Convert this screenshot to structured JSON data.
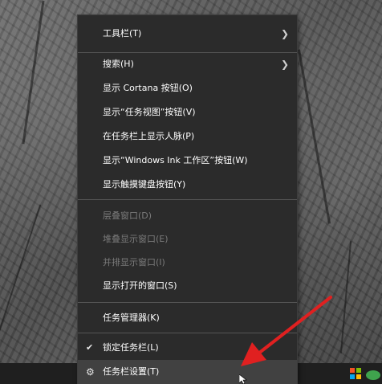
{
  "menu": {
    "items": [
      {
        "label": "工具栏(T)",
        "enabled": true,
        "submenu": true
      },
      {
        "label": "搜索(H)",
        "enabled": true,
        "submenu": true
      },
      {
        "label": "显示 Cortana 按钮(O)",
        "enabled": true
      },
      {
        "label": "显示“任务视图”按钮(V)",
        "enabled": true
      },
      {
        "label": "在任务栏上显示人脉(P)",
        "enabled": true
      },
      {
        "label": "显示“Windows Ink 工作区”按钮(W)",
        "enabled": true
      },
      {
        "label": "显示触摸键盘按钮(Y)",
        "enabled": true
      },
      {
        "label": "层叠窗口(D)",
        "enabled": false
      },
      {
        "label": "堆叠显示窗口(E)",
        "enabled": false
      },
      {
        "label": "并排显示窗口(I)",
        "enabled": false
      },
      {
        "label": "显示打开的窗口(S)",
        "enabled": true
      },
      {
        "label": "任务管理器(K)",
        "enabled": true
      },
      {
        "label": "锁定任务栏(L)",
        "enabled": true,
        "checked": true
      },
      {
        "label": "任务栏设置(T)",
        "enabled": true,
        "icon": "gear-icon",
        "highlighted": true
      }
    ]
  },
  "colors": {
    "menu_bg": "#2b2b2b",
    "text": "#ffffff",
    "disabled_text": "#7a7a7a",
    "highlight_bg": "#414141",
    "annotation_arrow": "#e02020"
  },
  "icons": {
    "submenu": "chevron-right-icon",
    "check": "checkmark-icon",
    "settings": "gear-icon"
  }
}
